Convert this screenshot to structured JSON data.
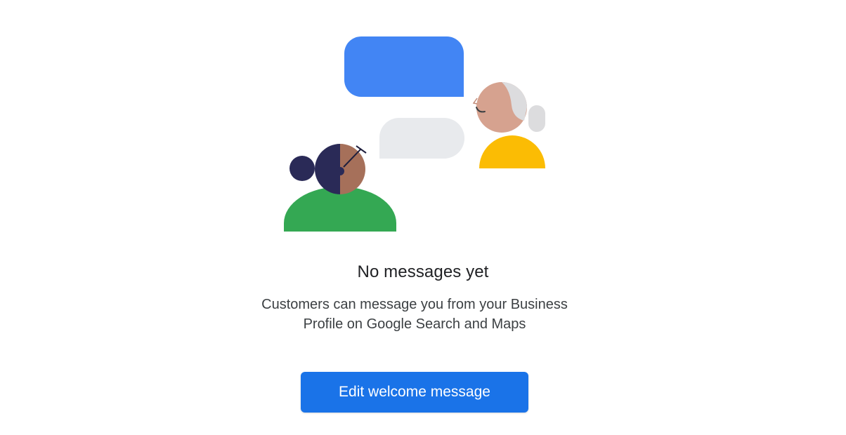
{
  "empty_state": {
    "illustration_icon": "conversation-illustration",
    "title": "No messages yet",
    "description": "Customers can message you from your Business Profile on Google Search and Maps",
    "button_label": "Edit welcome message"
  },
  "colors": {
    "accent": "#1a73e8",
    "bubble_blue": "#4285f4",
    "bubble_gray": "#e8eaed",
    "green": "#34a853",
    "yellow": "#fbbc04",
    "navy": "#2a2a57",
    "skin_dark": "#a6705a",
    "skin_light": "#d6a28f",
    "hair_gray": "#dcdcde"
  }
}
